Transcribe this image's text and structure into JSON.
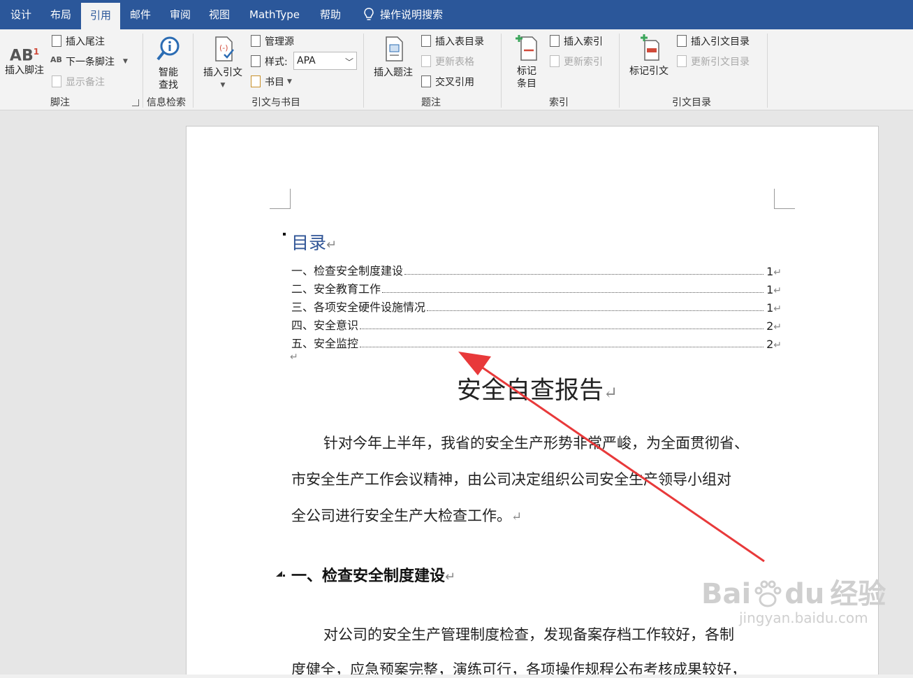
{
  "tabs": [
    "设计",
    "布局",
    "引用",
    "邮件",
    "审阅",
    "视图",
    "MathType",
    "帮助"
  ],
  "active_tab": "引用",
  "tell_me": "操作说明搜索",
  "ribbon": {
    "footnotes": {
      "label": "脚注",
      "insert_footnote": "插入脚注",
      "insert_endnote": "插入尾注",
      "next_footnote": "下一条脚注",
      "show_notes": "显示备注",
      "ab_text": "AB",
      "ab_sup": "1"
    },
    "research": {
      "label": "信息检索",
      "smart_lookup_line1": "智能",
      "smart_lookup_line2": "查找"
    },
    "citations": {
      "label": "引文与书目",
      "insert_citation": "插入引文",
      "manage_sources": "管理源",
      "style_label": "样式:",
      "style_value": "APA",
      "bibliography": "书目"
    },
    "captions": {
      "label": "题注",
      "insert_caption": "插入题注",
      "insert_table_of_figures": "插入表目录",
      "update_table": "更新表格",
      "cross_reference": "交叉引用"
    },
    "index": {
      "label": "索引",
      "mark_entry_line1": "标记",
      "mark_entry_line2": "条目",
      "insert_index": "插入索引",
      "update_index": "更新索引"
    },
    "authorities": {
      "label": "引文目录",
      "mark_citation": "标记引文",
      "insert_toa": "插入引文目录",
      "update_toa": "更新引文目录"
    }
  },
  "document": {
    "toc_heading": "目录",
    "toc": [
      {
        "title": "一、检查安全制度建设",
        "page": "1"
      },
      {
        "title": "二、安全教育工作",
        "page": "1"
      },
      {
        "title": "三、各项安全硬件设施情况",
        "page": "1"
      },
      {
        "title": "四、安全意识",
        "page": "2"
      },
      {
        "title": "五、安全监控",
        "page": "2"
      }
    ],
    "title": "安全自查报告",
    "paragraph1": [
      "针对今年上半年，我省的安全生产形势非常严峻，为全面贯彻省、",
      "市安全生产工作会议精神，由公司决定组织公司安全生产领导小组对",
      "全公司进行安全生产大检查工作。"
    ],
    "heading1": "一、检查安全制度建设",
    "paragraph2": [
      "对公司的安全生产管理制度检查，发现备案存档工作较好，各制",
      "度健全，应急预案完整，演练可行，各项操作规程公布考核成果较好，"
    ],
    "paragraph_mark": "↵"
  },
  "watermark": {
    "brand": "Bai",
    "brand2": "du",
    "cn": "经验",
    "url": "jingyan.baidu.com"
  },
  "colors": {
    "ribbon_blue": "#2b579a",
    "toc_blue": "#2f5496",
    "arrow_red": "#e8393a"
  }
}
